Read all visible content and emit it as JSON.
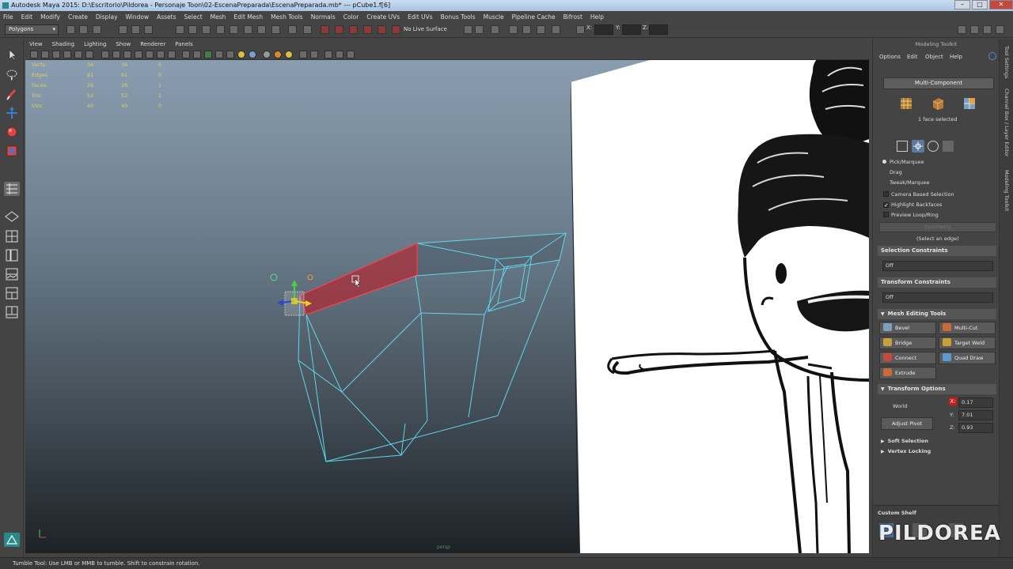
{
  "window": {
    "title": "Autodesk Maya 2015: D:\\Escritorio\\Pildorea - Personaje Toon\\02-EscenaPreparada\\EscenaPreparada.mb*  ---  pCube1.f[6]"
  },
  "menubar": [
    "File",
    "Edit",
    "Modify",
    "Create",
    "Display",
    "Window",
    "Assets",
    "Select",
    "Mesh",
    "Edit Mesh",
    "Mesh Tools",
    "Normals",
    "Color",
    "Create UVs",
    "Edit UVs",
    "Bonus Tools",
    "Muscle",
    "Pipeline Cache",
    "Bifrost",
    "Help"
  ],
  "statusline": {
    "mode": "Polygons",
    "live_surface": "No Live Surface",
    "x_label": "X:",
    "y_label": "Y:",
    "z_label": "Z:"
  },
  "panel_menu": [
    "View",
    "Shading",
    "Lighting",
    "Show",
    "Renderer",
    "Panels"
  ],
  "hud": {
    "rows": [
      {
        "label": "Verts:",
        "a": "36",
        "b": "36",
        "c": "0"
      },
      {
        "label": "Edges:",
        "a": "61",
        "b": "61",
        "c": "0"
      },
      {
        "label": "Faces:",
        "a": "26",
        "b": "26",
        "c": "1"
      },
      {
        "label": "Tris:",
        "a": "52",
        "b": "52",
        "c": "2"
      },
      {
        "label": "UVs:",
        "a": "40",
        "b": "40",
        "c": "0"
      }
    ],
    "camera": "persp"
  },
  "toolkit": {
    "title": "Modeling Toolkit",
    "menu": [
      "Options",
      "Edit",
      "Object",
      "Help"
    ],
    "mode_button": "Multi-Component",
    "selection_count": "1 face selected",
    "pick_modes": [
      "Pick/Marquee",
      "Drag",
      "Tweak/Marquee"
    ],
    "options": {
      "camera_based": "Camera Based Selection",
      "highlight_backfaces": "Highlight Backfaces",
      "preview_loop": "Preview Loop/Ring"
    },
    "symmetry_button": "Symmetry",
    "select_edge_hint": "(Select an edge)",
    "selection_constraints": {
      "title": "Selection Constraints",
      "value": "Off"
    },
    "transform_constraints": {
      "title": "Transform Constraints",
      "value": "Off"
    },
    "mesh_editing": {
      "title": "Mesh Editing Tools",
      "tools": [
        "Bevel",
        "Multi-Cut",
        "Bridge",
        "Target Weld",
        "Connect",
        "Quad Draw",
        "Extrude"
      ]
    },
    "transform_options": {
      "title": "Transform Options",
      "space": "World",
      "adjust_pivot": "Adjust Pivot",
      "x_label": "X:",
      "x": "0.17",
      "y_label": "Y:",
      "y": "7.01",
      "z_label": "Z:",
      "z": "0.93"
    },
    "soft_selection": "Soft Selection",
    "vertex_locking": "Vertex Locking",
    "custom_shelf": "Custom Shelf"
  },
  "side_tabs": [
    "Tool Settings",
    "Channel Box / Layer Editor",
    "Modeling Toolkit"
  ],
  "helpline": "Tumble Tool: Use LMB or MMB to tumble. Shift to constrain rotation.",
  "watermark": "PILDOREA",
  "colors": {
    "wireframe": "#5fd6ea",
    "selected_face": "#d0202c",
    "hud_text": "#d8d060"
  }
}
